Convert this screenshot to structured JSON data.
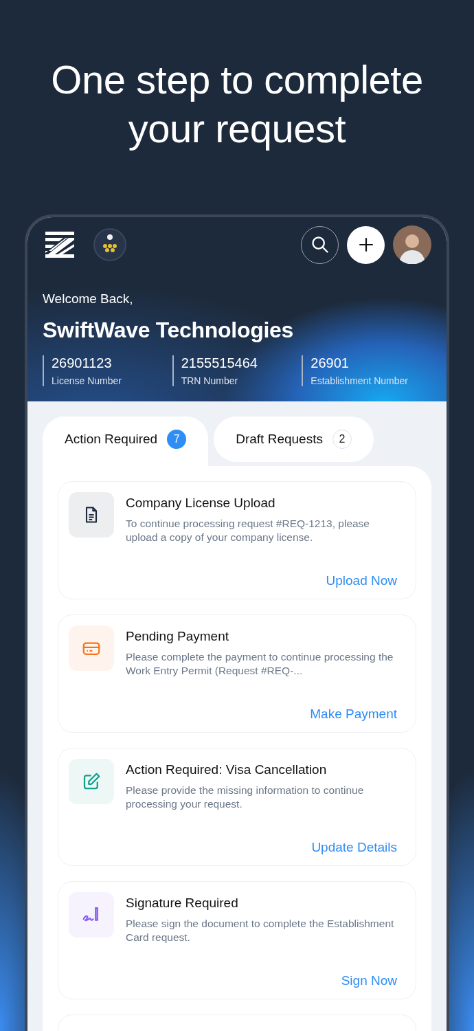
{
  "headline": "One step to complete your request",
  "header": {
    "welcome": "Welcome Back,",
    "company": "SwiftWave Technologies",
    "stats": [
      {
        "value": "26901123",
        "label": "License Number"
      },
      {
        "value": "2155515464",
        "label": "TRN Number"
      },
      {
        "value": "26901",
        "label": "Establishment Number"
      }
    ]
  },
  "tabs": [
    {
      "label": "Action Required",
      "count": "7",
      "selected": true
    },
    {
      "label": "Draft Requests",
      "count": "2",
      "selected": false
    }
  ],
  "requests": [
    {
      "kind": "document",
      "color": "#1e293b",
      "title": "Company License Upload",
      "description": "To continue processing request #REQ-1213, please upload a copy of your company license.",
      "action": "Upload Now"
    },
    {
      "kind": "card",
      "color": "#f97316",
      "title": "Pending Payment",
      "description": "Please complete the payment to continue processing the Work Entry Permit (Request #REQ-...",
      "action": "Make Payment"
    },
    {
      "kind": "edit",
      "color": "#0f9f8a",
      "title": "Action Required: Visa Cancellation",
      "description": "Please provide the missing information to continue processing your request.",
      "action": "Update Details"
    },
    {
      "kind": "signature",
      "color": "#8b5cf6",
      "title": "Signature Required",
      "description": "Please sign the document to complete the Establishment Card request.",
      "action": "Sign Now"
    }
  ]
}
